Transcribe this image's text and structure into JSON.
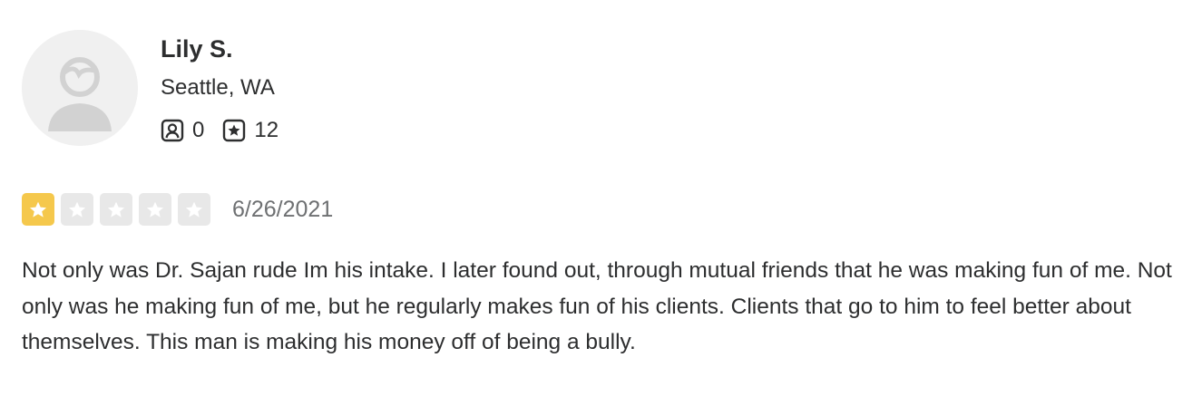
{
  "user": {
    "name": "Lily S.",
    "location": "Seattle, WA",
    "friends_count": "0",
    "reviews_count": "12",
    "friends_icon": "friends-icon",
    "reviews_icon": "review-star-icon",
    "avatar_icon": "default-avatar-icon"
  },
  "review": {
    "rating": 1,
    "max_rating": 5,
    "date": "6/26/2021",
    "text": "Not only was Dr. Sajan rude Im his intake. I later found out, through mutual friends that he was making fun of me. Not only was he making fun of me, but he regularly makes fun of his clients. Clients that go to him to feel better about themselves. This man is making his money off of being a bully."
  },
  "colors": {
    "star_filled": "#f5c84c",
    "star_empty": "#e8e8e8",
    "text": "#2d2e2f",
    "muted": "#6e7072"
  }
}
